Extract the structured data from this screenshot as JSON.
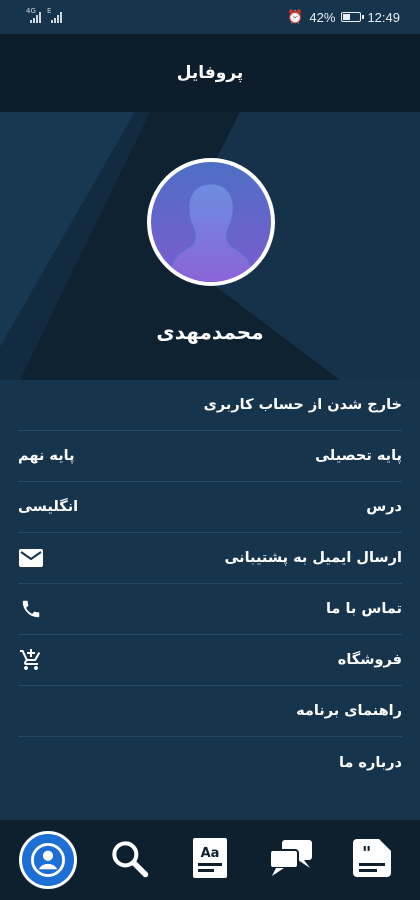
{
  "status_bar": {
    "left_sim1": "4G",
    "left_sim2": "E",
    "battery_percent": 42,
    "battery_text": "42%",
    "time": "12:49",
    "alarm": "⏰"
  },
  "header": {
    "title": "پروفایل"
  },
  "profile": {
    "name": "محمدمهدی"
  },
  "menu": {
    "logout": "خارج شدن از حساب کاربری",
    "grade_label": "پایه تحصیلی",
    "grade_value": "پایه نهم",
    "lesson_label": "درس",
    "lesson_value": "انگلیسی",
    "email_label": "ارسال ایمیل به پشتیبانی",
    "contact_label": "تماس با ما",
    "store_label": "فروشگاه",
    "guide_label": "راهنمای برنامه",
    "about_label": "درباره ما"
  },
  "icons": {
    "email": "email-icon",
    "phone": "phone-icon",
    "cart": "cart-icon",
    "profile_tab": "profile-icon",
    "search_tab": "search-icon",
    "dictionary_tab": "dictionary-icon",
    "chat_tab": "chat-icon",
    "quote_tab": "quote-icon"
  },
  "colors": {
    "background": "#17344d",
    "header": "#0d1d2b",
    "accent": "#1d6fd6",
    "divider": "#244b69"
  }
}
